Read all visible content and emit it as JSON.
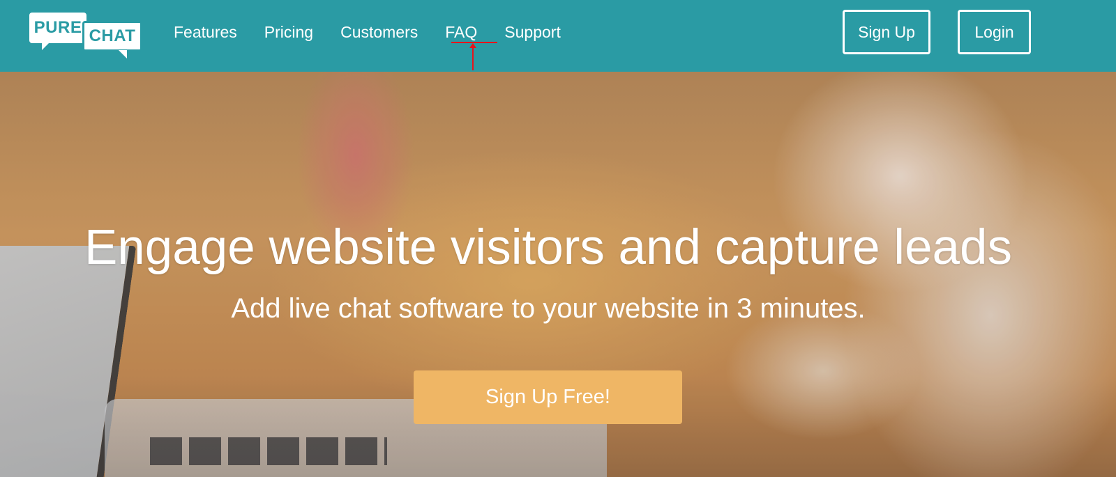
{
  "brand": {
    "logo_word_1": "PURE",
    "logo_word_2": "CHAT",
    "color_primary": "#2a9ba4",
    "color_cta": "#efb665"
  },
  "nav": {
    "items": [
      {
        "label": "Features"
      },
      {
        "label": "Pricing"
      },
      {
        "label": "Customers"
      },
      {
        "label": "FAQ"
      },
      {
        "label": "Support"
      }
    ],
    "signup_label": "Sign Up",
    "login_label": "Login"
  },
  "annotation": {
    "highlighted_item": "FAQ",
    "color": "#e8141b"
  },
  "hero": {
    "title": "Engage website visitors and capture leads",
    "subtitle": "Add live chat software to your website in 3 minutes.",
    "cta_label": "Sign Up Free!"
  }
}
